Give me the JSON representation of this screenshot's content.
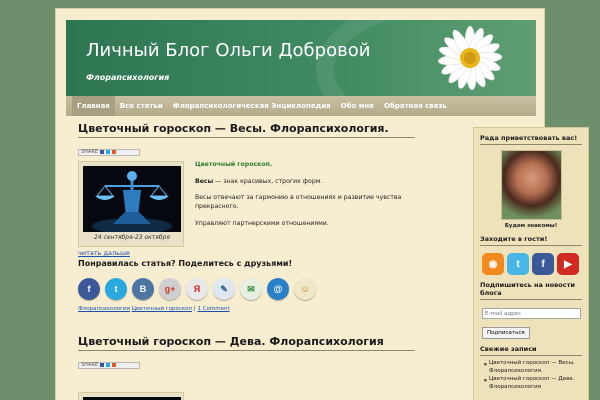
{
  "site": {
    "title": "Личный Блог Ольги Добровой",
    "subtitle": "Флорапсихология"
  },
  "nav": {
    "items": [
      {
        "label": "Главная",
        "active": true
      },
      {
        "label": "Все статьи",
        "active": false
      },
      {
        "label": "Флорапсихологическая Энциклопедия",
        "active": false
      },
      {
        "label": "Обо мне",
        "active": false
      },
      {
        "label": "Обратная связь",
        "active": false
      }
    ]
  },
  "share": {
    "label": "SHARE"
  },
  "post1": {
    "title": "Цветочный гороскоп — Весы. Флорапсихология.",
    "image_caption": "24 сентября-23 октября",
    "intro": "Цветочный гороскоп.",
    "para1_bold": "Весы",
    "para1_rest": " — знак красивых, строгих форм.",
    "para2": "Весы отвечают за гармонию в отношениях и развитие чувства прекрасного.",
    "para3": "Управляют партнерскими отношениями.",
    "read_more": "читать дальше",
    "like_heading": "Понравилась статья? Поделитесь с друзьями!",
    "social": [
      {
        "icon": "facebook-icon",
        "glyph": "f",
        "color": "#3b5998"
      },
      {
        "icon": "twitter-icon",
        "glyph": "t",
        "color": "#2aa9e0"
      },
      {
        "icon": "vkontakte-icon",
        "glyph": "B",
        "color": "#4c75a3"
      },
      {
        "icon": "google-plus-icon",
        "glyph": "g+",
        "color": "#d0d0d0"
      },
      {
        "icon": "yandex-icon",
        "glyph": "Я",
        "color": "#e8e8e8"
      },
      {
        "icon": "livejournal-icon",
        "glyph": "✎",
        "color": "#dfe8f0"
      },
      {
        "icon": "myworld-icon",
        "glyph": "✉",
        "color": "#e7efe0"
      },
      {
        "icon": "mailru-icon",
        "glyph": "@",
        "color": "#2a80c8"
      },
      {
        "icon": "odnoklassniki-icon",
        "glyph": "☺",
        "color": "#efe7c8"
      }
    ],
    "categories": [
      "Флорапсихология",
      "Цветочный гороскоп"
    ],
    "comments": "1 Comment"
  },
  "post2": {
    "title": "Цветочный гороскоп — Дева. Флорапсихология"
  },
  "sidebar": {
    "welcome_title": "Рада приветствовать вас!",
    "avatar_caption": "Будем знакомы!",
    "visit_title": "Заходите в гости!",
    "visit_icons": [
      {
        "icon": "rss-icon",
        "glyph": "◉",
        "color": "#f28a1f"
      },
      {
        "icon": "twitter-bird-icon",
        "glyph": "t",
        "color": "#48b6e6"
      },
      {
        "icon": "facebook-square-icon",
        "glyph": "f",
        "color": "#3b5998"
      },
      {
        "icon": "youtube-icon",
        "glyph": "▶",
        "color": "#d12a22"
      }
    ],
    "subscribe_title": "Подпишитесь на новости блога",
    "email_placeholder": "E-mail адрес",
    "subscribe_button": "Подписаться",
    "recent_title": "Свежие записи",
    "recent_items": [
      "Цветочный гороскоп — Весы. Флорапсихология.",
      "Цветочный гороскоп — Дева. Флорапсихология"
    ]
  }
}
